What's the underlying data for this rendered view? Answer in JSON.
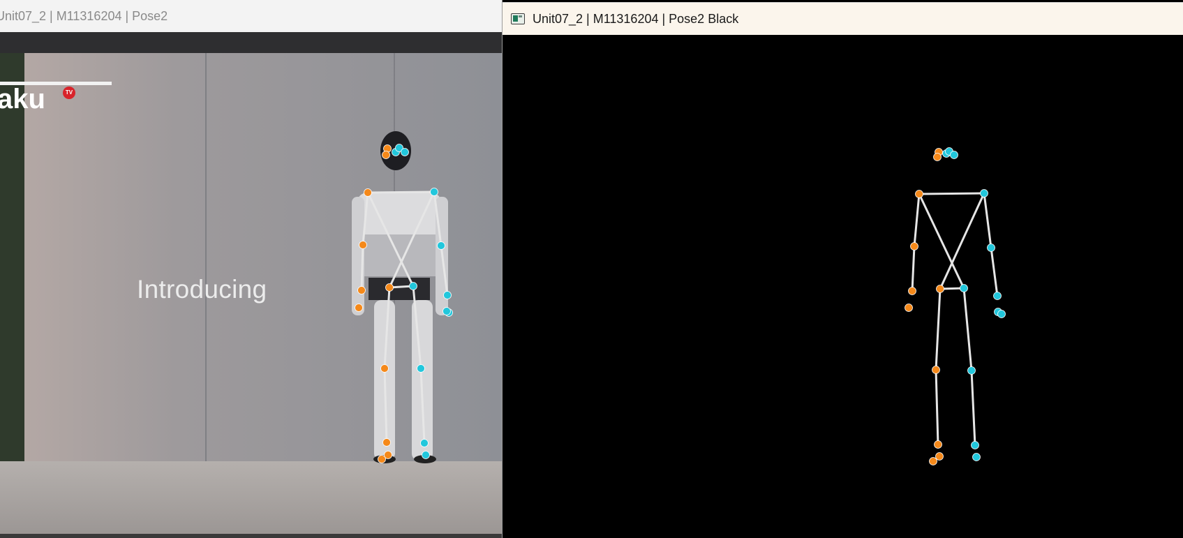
{
  "windows": {
    "left": {
      "title": "Unit07_2 | M11316204 | Pose2"
    },
    "right": {
      "title": "Unit07_2 | M11316204 | Pose2 Black"
    }
  },
  "video": {
    "caption": "Introducing",
    "brand_text": "aku",
    "brand_badge": "TV"
  },
  "colors": {
    "skeleton_line": "#e6e6e6",
    "left_keypoint": "#f5891a",
    "right_keypoint": "#22c7dc",
    "black_background": "#000000"
  }
}
